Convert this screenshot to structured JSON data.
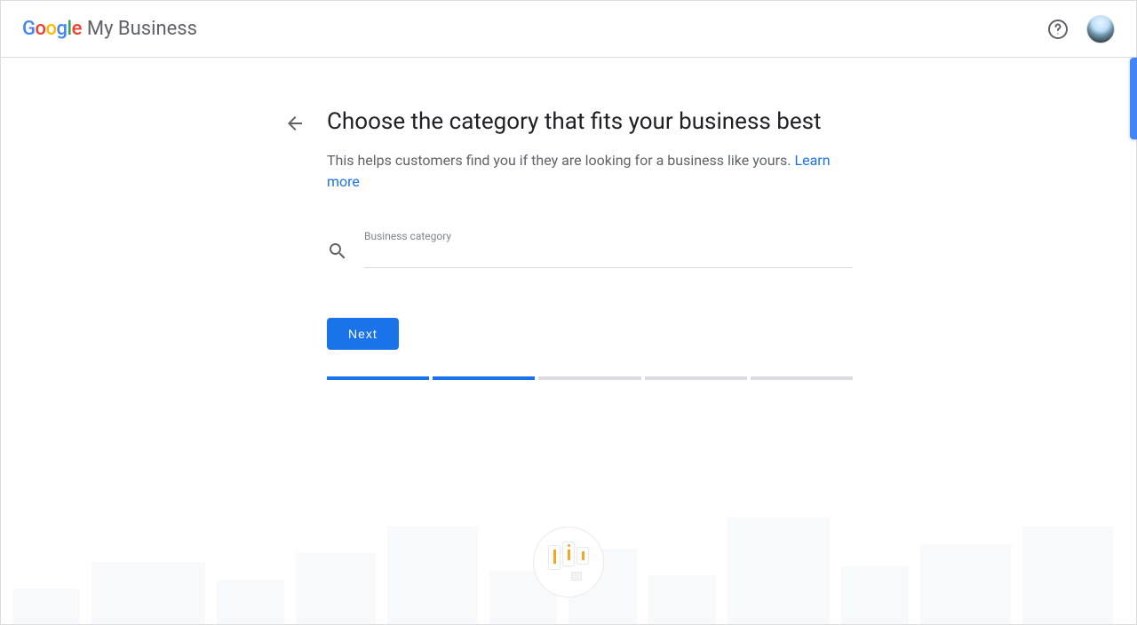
{
  "header": {
    "logo_letters": [
      "G",
      "o",
      "o",
      "g",
      "l",
      "e"
    ],
    "product_name": "My Business"
  },
  "main": {
    "title": "Choose the category that fits your business best",
    "subtitle_prefix": "This helps customers find you if they are looking for a business like yours. ",
    "learn_more_label": "Learn more",
    "field_label": "Business category",
    "field_value": "",
    "next_label": "Next"
  },
  "progress": {
    "total": 5,
    "completed": 2
  }
}
